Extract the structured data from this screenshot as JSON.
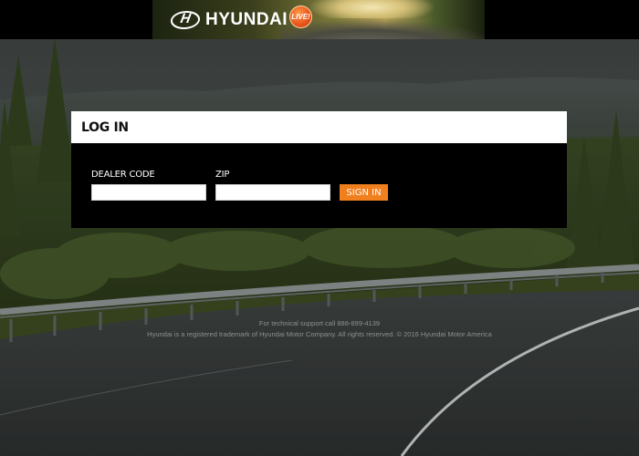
{
  "header": {
    "brand": "HYUNDAI",
    "live_badge": "LIVE!"
  },
  "login": {
    "title": "LOG IN",
    "dealer_code_label": "DEALER CODE",
    "dealer_code_value": "",
    "zip_label": "ZIP",
    "zip_value": "",
    "signin_label": "SIGN IN"
  },
  "footer": {
    "support": "For technical support call 888-899-4139",
    "copyright": "Hyundai is a registered trademark of Hyundai Motor Company. All rights reserved. © 2016 Hyundai Motor America"
  },
  "colors": {
    "accent": "#f07f1e",
    "panel_header": "#ffffff",
    "panel_body": "#000000"
  },
  "icons": {
    "logo": "hyundai-logo-icon",
    "badge": "live-badge-icon"
  }
}
